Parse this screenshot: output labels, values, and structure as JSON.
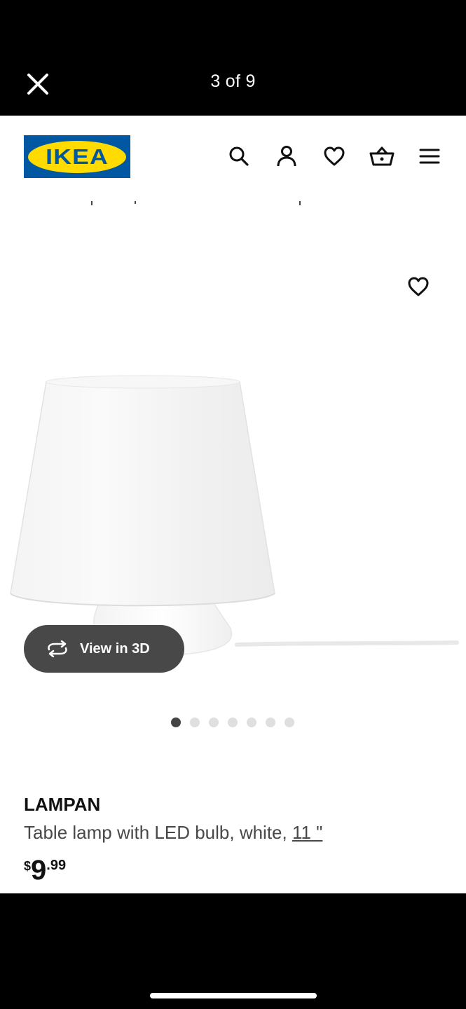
{
  "viewer": {
    "counter": "3 of 9",
    "close_icon": "close-icon"
  },
  "header": {
    "logo_text": "IKEA",
    "icons": [
      "search-icon",
      "user-icon",
      "heart-icon",
      "basket-icon",
      "menu-icon"
    ]
  },
  "product": {
    "image_alt": "table lamp",
    "view3d_label": "View in 3D",
    "gallery_total": 7,
    "gallery_active": 1,
    "name": "LAMPAN",
    "description": "Table lamp with LED bulb, white, ",
    "size": "11 \"",
    "price": {
      "currency": "$",
      "integer": "9",
      "decimal": ".99"
    }
  },
  "colors": {
    "ikea_blue": "#0058a3",
    "ikea_yellow": "#ffdb00",
    "button_dark": "#484848"
  }
}
